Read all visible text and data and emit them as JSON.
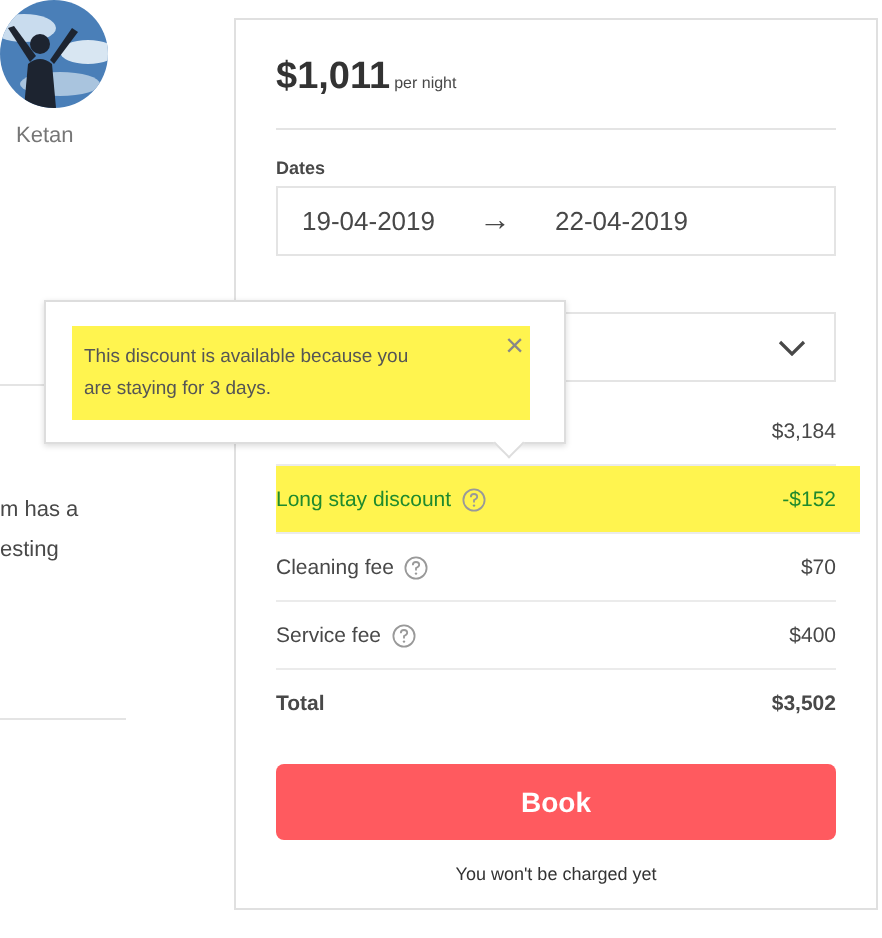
{
  "host": {
    "name": "Ketan"
  },
  "description": {
    "lines": [
      "m has a",
      "esting"
    ]
  },
  "booking": {
    "price": "$1,011",
    "price_unit": "per night",
    "dates": {
      "label": "Dates",
      "check_in": "19-04-2019",
      "arrow": "→",
      "check_out": "22-04-2019"
    },
    "guests": {
      "expanded": false
    },
    "rows": [
      {
        "kind": "charge",
        "value": "$3,184",
        "help": false,
        "highlighted": false
      },
      {
        "kind": "discount",
        "label": "Long stay discount",
        "value": "-$152",
        "help": true,
        "highlighted": true
      },
      {
        "kind": "charge",
        "label": "Cleaning fee",
        "value": "$70",
        "help": true,
        "highlighted": false
      },
      {
        "kind": "charge",
        "label": "Service fee",
        "value": "$400",
        "help": true,
        "highlighted": false
      },
      {
        "kind": "total",
        "label": "Total",
        "value": "$3,502",
        "help": false,
        "highlighted": false
      }
    ],
    "book_button": "Book",
    "note": "You won't be charged yet"
  },
  "tooltip": {
    "text": "This discount is available because you are staying for 3 days.",
    "highlighted": true,
    "close": "×"
  }
}
